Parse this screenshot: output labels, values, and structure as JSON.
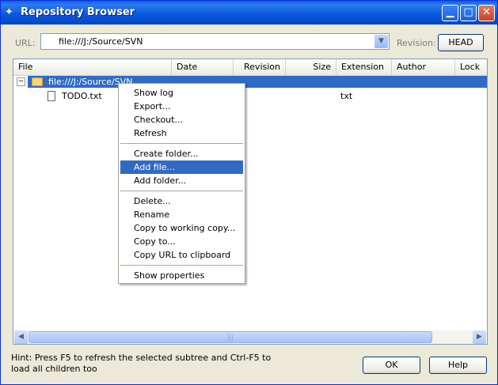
{
  "window": {
    "title": "Repository Browser"
  },
  "toolbar": {
    "url_label": "URL:",
    "url_value": "file:///J:/Source/SVN",
    "revision_label": "Revision:",
    "revision_button": "HEAD"
  },
  "columns": [
    "File",
    "Date",
    "Revision",
    "Size",
    "Extension",
    "Author",
    "Lock"
  ],
  "tree": {
    "root": {
      "label": "file:///J:/Source/SVN"
    },
    "children": [
      {
        "name": "TODO.txt",
        "extension": "txt"
      }
    ]
  },
  "context_menu": {
    "groups": [
      [
        "Show log",
        "Export...",
        "Checkout...",
        "Refresh"
      ],
      [
        "Create folder...",
        "Add file...",
        "Add folder..."
      ],
      [
        "Delete...",
        "Rename",
        "Copy to working copy...",
        "Copy to...",
        "Copy URL to clipboard"
      ],
      [
        "Show properties"
      ]
    ],
    "highlighted": "Add file..."
  },
  "footer": {
    "hint": "Hint: Press F5 to refresh the selected subtree and Ctrl-F5 to load all children too",
    "ok_label": "OK",
    "help_label": "Help"
  }
}
